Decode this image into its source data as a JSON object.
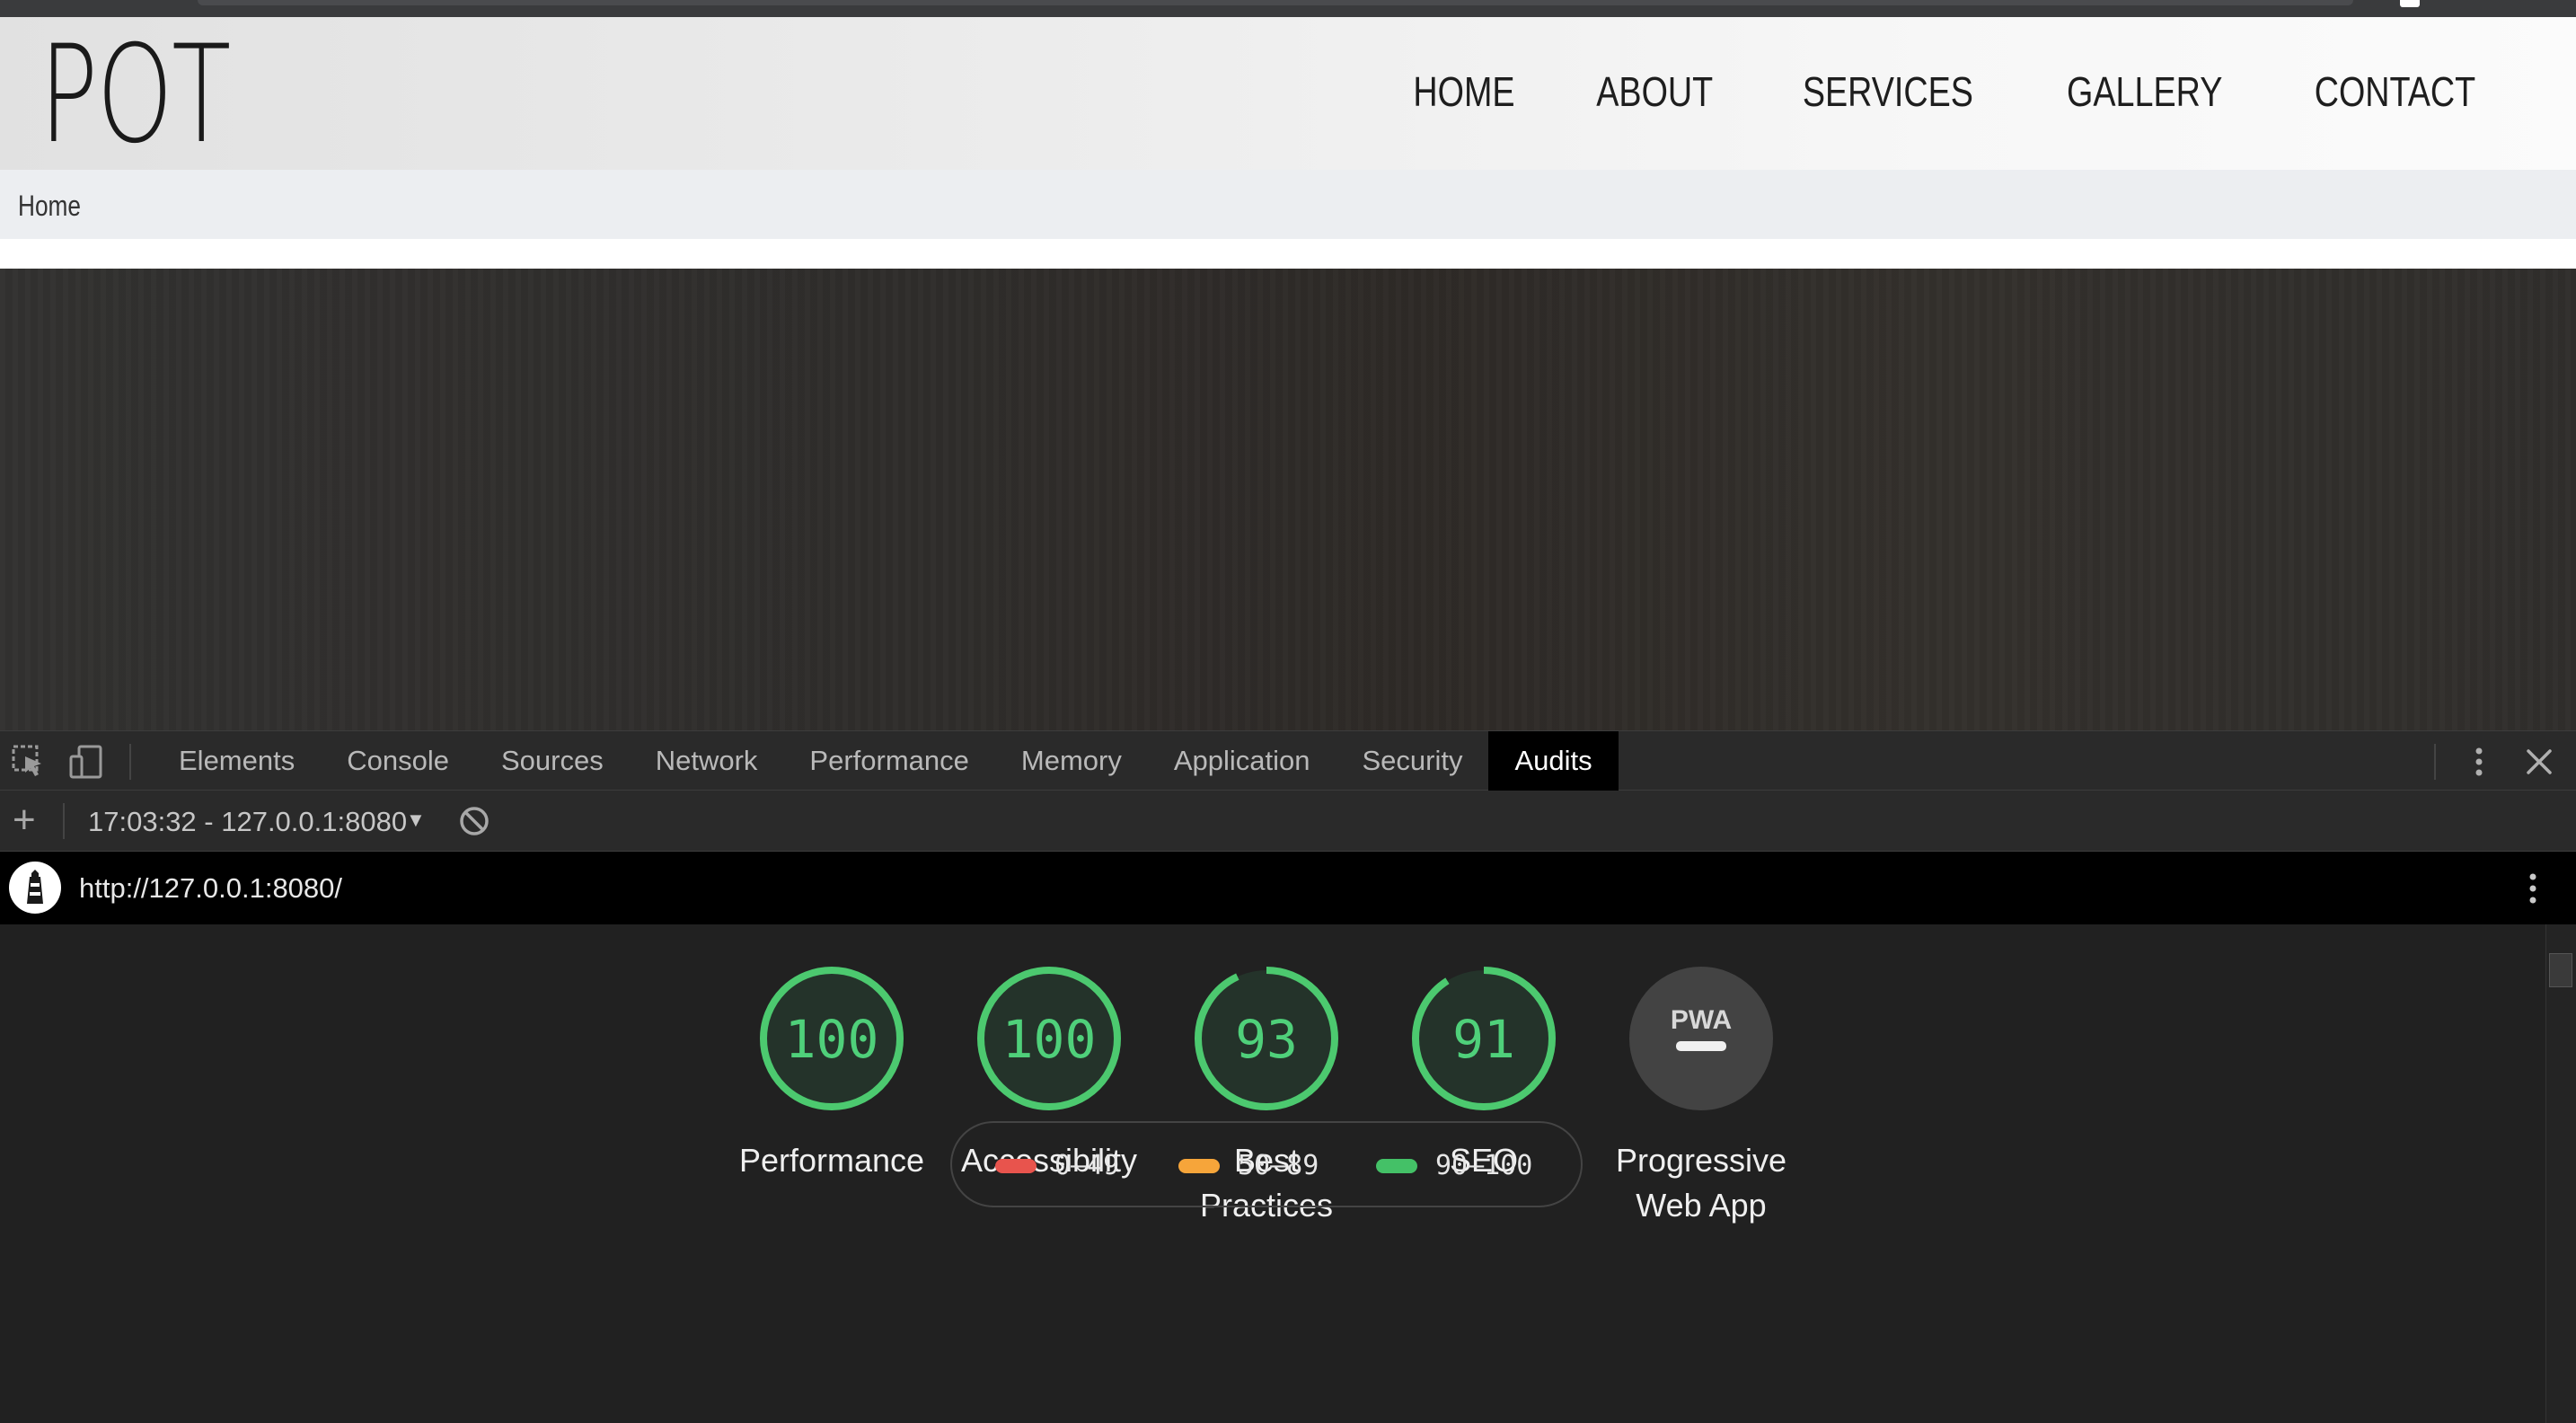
{
  "site": {
    "logo": "POT",
    "nav": [
      "HOME",
      "ABOUT",
      "SERVICES",
      "GALLERY",
      "CONTACT"
    ],
    "breadcrumb": "Home"
  },
  "devtools": {
    "tabs": [
      "Elements",
      "Console",
      "Sources",
      "Network",
      "Performance",
      "Memory",
      "Application",
      "Security",
      "Audits"
    ],
    "active_tab": "Audits",
    "session": "17:03:32 - 127.0.0.1:8080",
    "url": "http://127.0.0.1:8080/",
    "icons": {
      "inspect": "inspect-element-icon",
      "device": "device-toolbar-icon",
      "more": "more-options-icon",
      "close": "close-icon",
      "add": "plus-icon",
      "clear": "block-icon",
      "lighthouse": "lighthouse-icon"
    }
  },
  "audits": {
    "categories": [
      {
        "score": "100",
        "label_lines": [
          "Performance"
        ],
        "fraction": 1.0
      },
      {
        "score": "100",
        "label_lines": [
          "Accessibility"
        ],
        "fraction": 1.0
      },
      {
        "score": "93",
        "label_lines": [
          "Best",
          "Practices"
        ],
        "fraction": 0.93
      },
      {
        "score": "91",
        "label_lines": [
          "SEO"
        ],
        "fraction": 0.91
      },
      {
        "score": "",
        "badge": "PWA",
        "label_lines": [
          "Progressive",
          "Web App"
        ],
        "fraction": 0
      }
    ],
    "legend": [
      {
        "range": "0–49",
        "color": "#e8544d"
      },
      {
        "range": "50–89",
        "color": "#f6a53a"
      },
      {
        "range": "90–100",
        "color": "#44c167"
      }
    ],
    "colors": {
      "pass": "#4fd07a",
      "pass_ring": "#4cc96f",
      "gauge_bg": "#24332a",
      "pwa_bg": "#434343"
    }
  }
}
